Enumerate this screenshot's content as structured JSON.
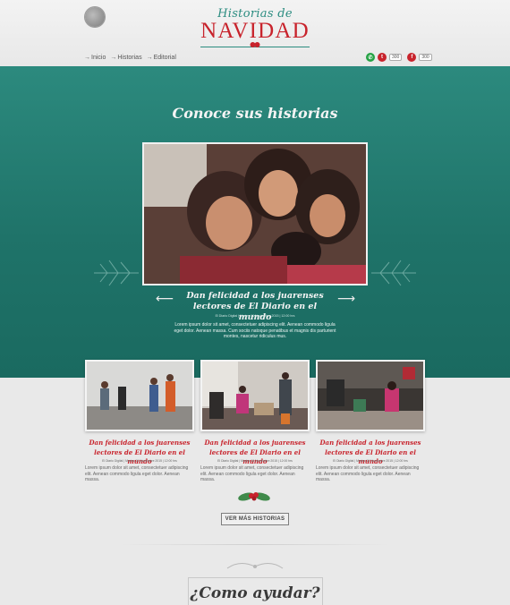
{
  "header": {
    "brand_script": "Historias de",
    "brand_title": "NAVIDAD",
    "breadcrumb": [
      {
        "label": "Inicio"
      },
      {
        "label": "Historias"
      },
      {
        "label": "Editorial"
      }
    ],
    "social": [
      {
        "icon": "whatsapp-icon",
        "glyph": "✆",
        "color": "#25a244",
        "count": ""
      },
      {
        "icon": "twitter-icon",
        "glyph": "t",
        "color": "#c8232c",
        "count": "300"
      },
      {
        "icon": "facebook-icon",
        "glyph": "f",
        "color": "#c8232c",
        "count": "300"
      }
    ]
  },
  "hero": {
    "title": "Conoce sus historias",
    "headline": "Dan felicidad a los juarenses lectores de El Diario en el mundo",
    "meta": "El Diario Digital | Martes 16 Noviembre 2015 | 12:00 hrs",
    "excerpt": "Lorem ipsum dolor sit amet, consectetuer adipiscing elit. Aenean commodo ligula eget dolor. Aenean massa. Cum sociis natoque penatibus et magnis dis parturient montes, nascetur ridiculus mus.",
    "prev_glyph": "⟵",
    "next_glyph": "⟶"
  },
  "stories": [
    {
      "title": "Dan felicidad a los juarenses lectores de El Diario en el mundo",
      "meta": "El Diario Digital | Martes 16 Noviembre 2015 | 12:00 hrs",
      "excerpt": "Lorem ipsum dolor sit amet, consectetuer adipiscing elit. Aenean commodo ligula eget dolor. Aenean massa."
    },
    {
      "title": "Dan felicidad a los juarenses lectores de El Diario en el mundo",
      "meta": "El Diario Digital | Martes 16 Noviembre 2015 | 12:00 hrs",
      "excerpt": "Lorem ipsum dolor sit amet, consectetuer adipiscing elit. Aenean commodo ligula eget dolor. Aenean massa."
    },
    {
      "title": "Dan felicidad a los juarenses lectores de El Diario en el mundo",
      "meta": "El Diario Digital | Martes 16 Noviembre 2015 | 12:00 hrs",
      "excerpt": "Lorem ipsum dolor sit amet, consectetuer adipiscing elit. Aenean commodo ligula eget dolor. Aenean massa."
    }
  ],
  "more_button": "VER MÁS HISTORIAS",
  "help": {
    "title": "¿Como ayudar?"
  },
  "colors": {
    "teal": "#2c8a7e",
    "red": "#c8232c",
    "page_bg": "#e9e9e9"
  }
}
